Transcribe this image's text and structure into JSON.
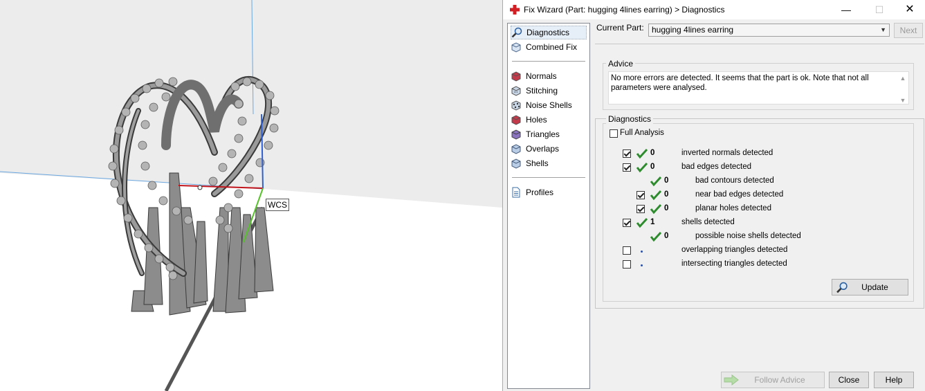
{
  "viewport": {
    "wcs_label": "WCS"
  },
  "window": {
    "title": "Fix Wizard (Part: hugging 4lines earring) > Diagnostics",
    "min_glyph": "—",
    "max_glyph": "☐",
    "close_glyph": "✕"
  },
  "nav": {
    "diagnostics": "Diagnostics",
    "combined_fix": "Combined Fix",
    "normals": "Normals",
    "stitching": "Stitching",
    "noise_shells": "Noise Shells",
    "holes": "Holes",
    "triangles": "Triangles",
    "overlaps": "Overlaps",
    "shells": "Shells",
    "profiles": "Profiles"
  },
  "current_part": {
    "label": "Current Part:",
    "value": "hugging 4lines earring"
  },
  "next_label": "Next",
  "advice": {
    "title": "Advice",
    "line1": "No more errors are detected. It seems that the part is ok. Note that not all",
    "line2": "parameters were analysed."
  },
  "diagnostics": {
    "title": "Diagnostics",
    "full_analysis": "Full Analysis",
    "rows": [
      {
        "count": "0",
        "label": "inverted normals detected"
      },
      {
        "count": "0",
        "label": "bad edges detected"
      },
      {
        "count": "0",
        "label": "bad contours detected"
      },
      {
        "count": "0",
        "label": "near bad edges detected"
      },
      {
        "count": "0",
        "label": "planar holes detected"
      },
      {
        "count": "1",
        "label": "shells detected"
      },
      {
        "count": "0",
        "label": "possible noise shells detected"
      },
      {
        "count": "",
        "label": "overlapping triangles detected"
      },
      {
        "count": "",
        "label": "intersecting triangles detected"
      }
    ]
  },
  "buttons": {
    "update": "Update",
    "follow_advice": "Follow Advice",
    "close": "Close",
    "help": "Help"
  },
  "colors": {
    "check_green": "#2e8b2e",
    "axis_red": "#c0141a",
    "axis_blue": "#2f5fd0",
    "axis_green": "#57c12c"
  }
}
